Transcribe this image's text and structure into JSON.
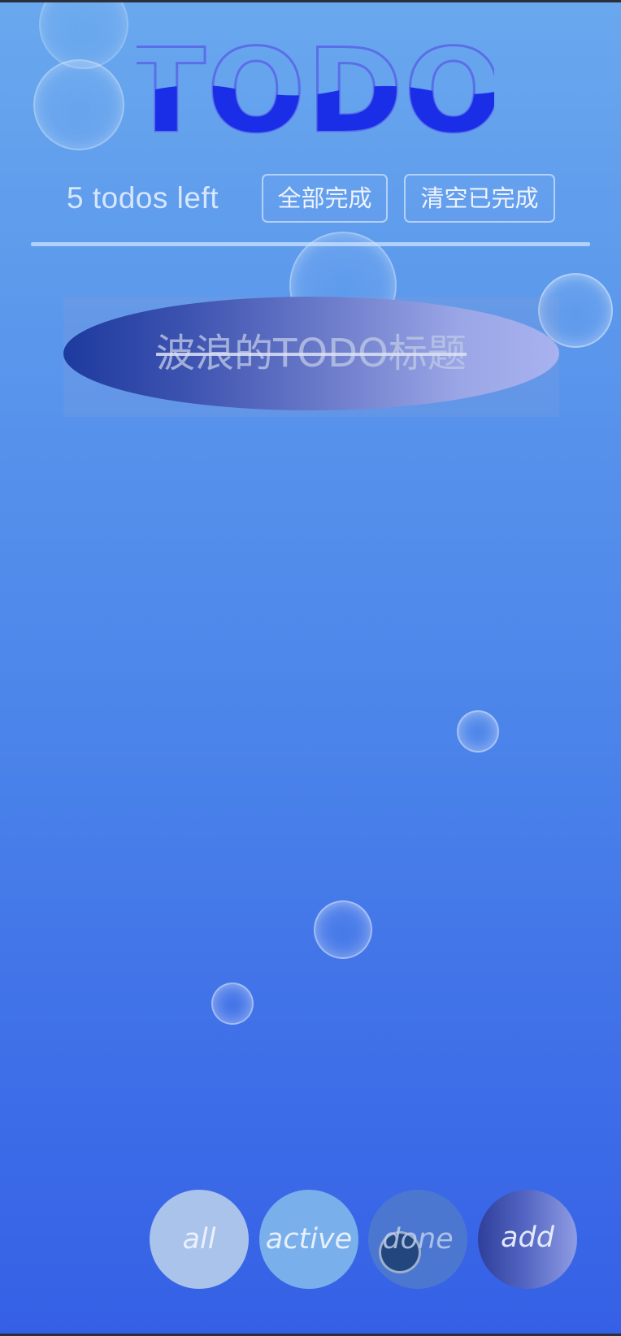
{
  "app": {
    "title": "TODO"
  },
  "header": {
    "todos_left": "5 todos left",
    "complete_all_label": "全部完成",
    "clear_completed_label": "清空已完成"
  },
  "todos": [
    {
      "title": "波浪的TODO标题",
      "completed": true
    }
  ],
  "filters": {
    "all_label": "all",
    "active_label": "active",
    "done_label": "done",
    "add_label": "add"
  },
  "colors": {
    "background_top": "#69a8ee",
    "background_bottom": "#3560e6",
    "title_fill": "#1a2ee8",
    "title_outline": "#5b6ee8"
  }
}
